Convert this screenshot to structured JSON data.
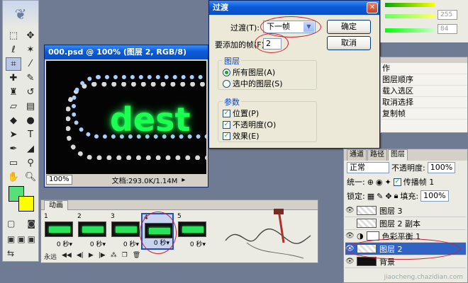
{
  "document": {
    "title": "000.psd @ 100% (图层 2, RGB/8)",
    "zoom": "100%",
    "doc_info": "文档:293.0K/1.14M",
    "canvas_text": "dest"
  },
  "animation": {
    "tab": "动画",
    "frames": [
      {
        "num": "1",
        "delay": "0 秒▾"
      },
      {
        "num": "2",
        "delay": "0 秒▾"
      },
      {
        "num": "3",
        "delay": "0 秒▾"
      },
      {
        "num": "4",
        "delay": "0 秒▾"
      },
      {
        "num": "5",
        "delay": "0 秒▾"
      }
    ],
    "loop": "永远"
  },
  "dialog": {
    "title": "过渡",
    "tween_label": "过渡(T):",
    "tween_value": "下一帧",
    "frames_label": "要添加的帧(F):",
    "frames_value": "2",
    "ok": "确定",
    "cancel": "取消",
    "layers_group": "图层",
    "all_layers": "所有图层(A)",
    "selected_layers": "选中的图层(S)",
    "params_group": "参数",
    "position": "位置(P)",
    "opacity": "不透明度(O)",
    "effects": "效果(E)"
  },
  "color_palette": {
    "values": [
      "255",
      "84"
    ]
  },
  "actions_palette": {
    "items": [
      "作",
      "图层顺序",
      "载入选区",
      "取消选择",
      "复制帧"
    ]
  },
  "layers_palette": {
    "tabs": [
      "通道",
      "路径",
      "图层"
    ],
    "blend_mode": "正常",
    "opacity_label": "不透明度:",
    "opacity_value": "100%",
    "unify_label": "统一:",
    "propagate_label": "传播帧 1",
    "lock_label": "锁定:",
    "fill_label": "填充:",
    "fill_value": "100%",
    "layers": [
      {
        "name": "图层 3"
      },
      {
        "name": "图层 2 副本"
      },
      {
        "name": "色彩平衡 1"
      },
      {
        "name": "图层 2"
      },
      {
        "name": "背景"
      }
    ]
  },
  "watermark": "jiaocheng.chazidian.com"
}
